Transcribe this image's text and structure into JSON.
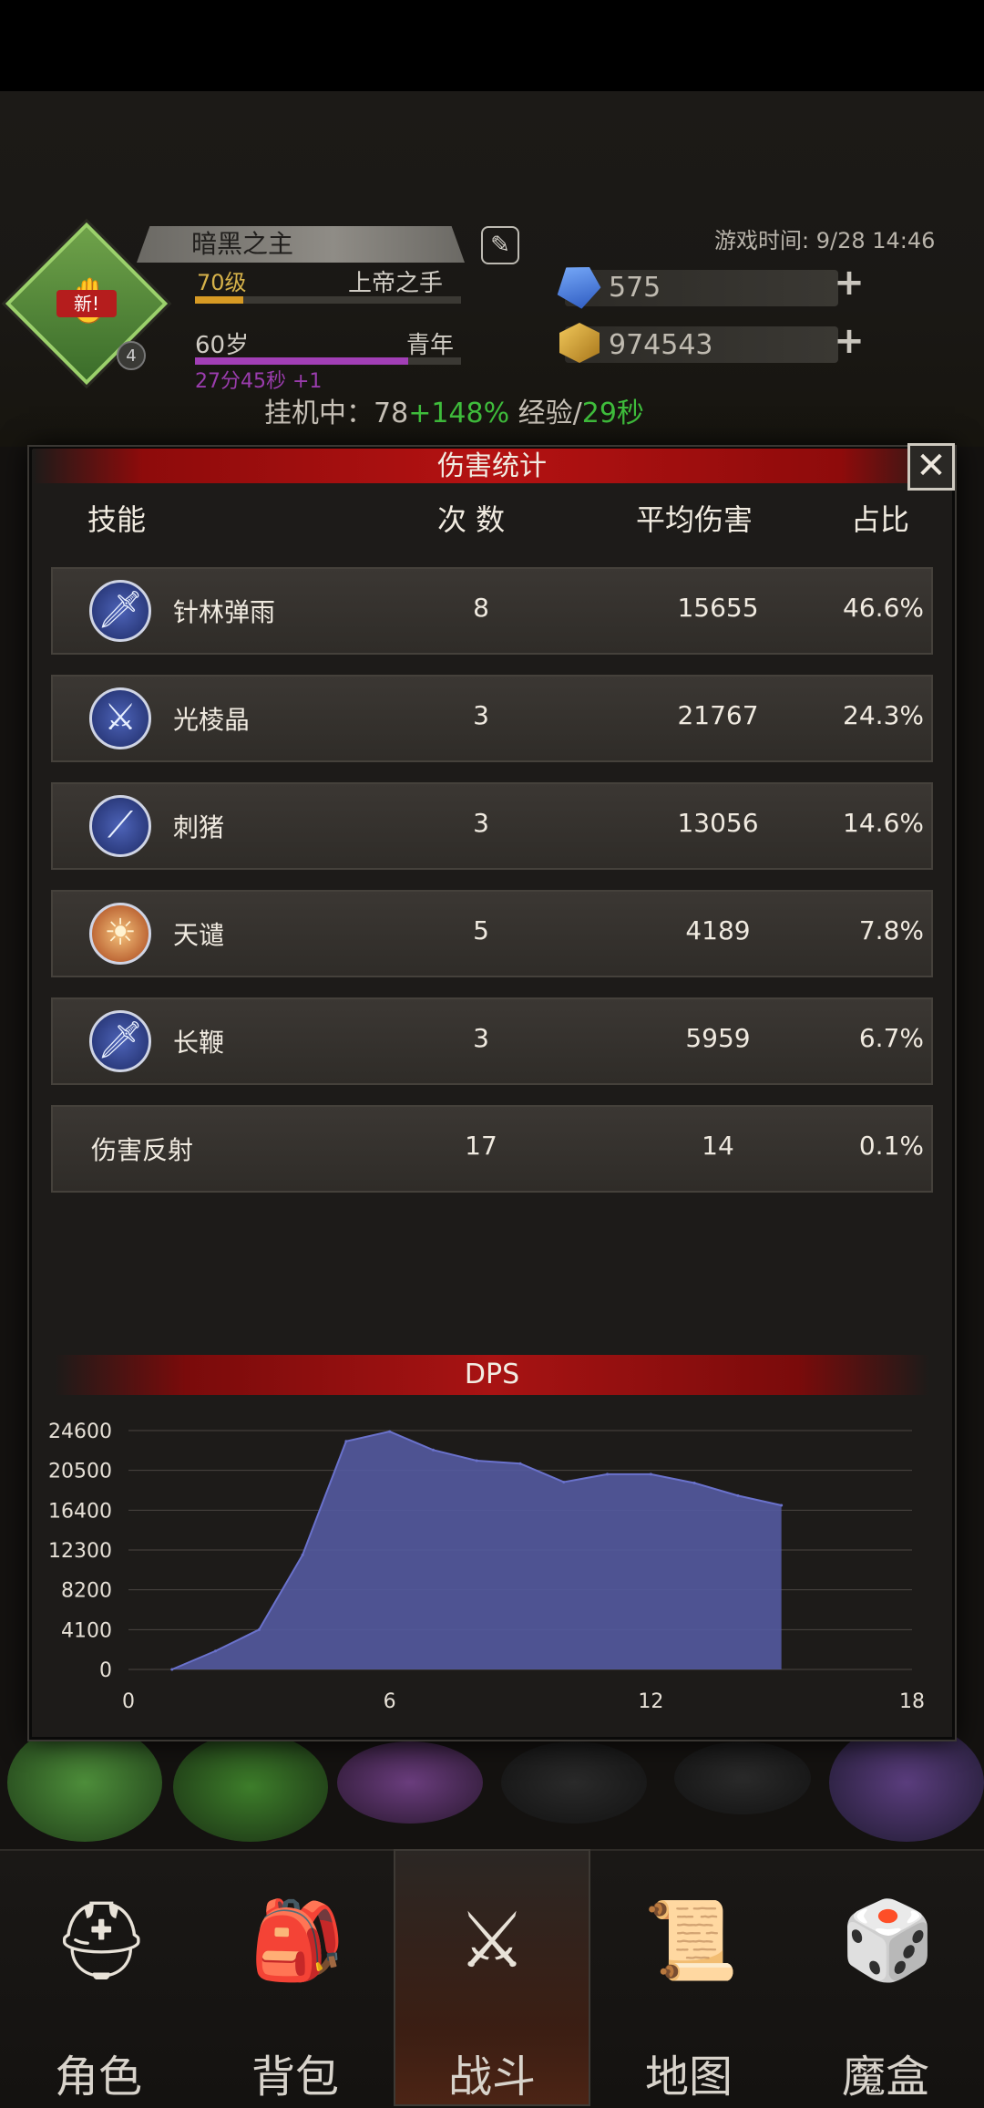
{
  "header": {
    "player_name": "暗黑之主",
    "level": "70级",
    "title": "上帝之手",
    "age": "60岁",
    "age_stage": "青年",
    "age_timer": "27分45秒 +1",
    "new_badge": "新!",
    "avatar_rank": "4",
    "game_time": "游戏时间: 9/28 14:46",
    "gems": "575",
    "gold": "974543",
    "level_progress": 0.18,
    "age_progress": 0.8,
    "idle": {
      "prefix": "挂机中：",
      "value": "78",
      "bonus": "+148%",
      "exp_label": "经验/",
      "interval": "29秒"
    }
  },
  "modal": {
    "title": "伤害统计",
    "close_symbol": "✕",
    "columns": {
      "skill": "技能",
      "count": "次 数",
      "avg": "平均伤害",
      "pct": "占比"
    },
    "rows": [
      {
        "icon": "sword-icon",
        "name": "针林弹雨",
        "count": "8",
        "avg": "15655",
        "pct": "46.6%"
      },
      {
        "icon": "blade-icon",
        "name": "光棱晶",
        "count": "3",
        "avg": "21767",
        "pct": "24.3%"
      },
      {
        "icon": "spikes-icon",
        "name": "刺猪",
        "count": "3",
        "avg": "13056",
        "pct": "14.6%"
      },
      {
        "icon": "fire-figure-icon",
        "name": "天谴",
        "count": "5",
        "avg": "4189",
        "pct": "7.8%"
      },
      {
        "icon": "sword-icon",
        "name": "长鞭",
        "count": "3",
        "avg": "5959",
        "pct": "6.7%"
      },
      {
        "icon": "",
        "name": "伤害反射",
        "count": "17",
        "avg": "14",
        "pct": "0.1%"
      }
    ],
    "dps_title": "DPS"
  },
  "chart_data": {
    "type": "area",
    "title": "DPS",
    "x": [
      1,
      2,
      3,
      4,
      5,
      6,
      7,
      8,
      9,
      10,
      11,
      12,
      13,
      14,
      15
    ],
    "values": [
      0,
      1900,
      4100,
      11800,
      23500,
      24500,
      22600,
      21500,
      21200,
      19300,
      20100,
      20100,
      19200,
      17900,
      16900
    ],
    "xticks": [
      "0",
      "6",
      "12",
      "18"
    ],
    "yticks": [
      "24600",
      "20500",
      "16400",
      "12300",
      "8200",
      "4100",
      "0"
    ],
    "xlim": [
      0,
      18
    ],
    "ylim": [
      0,
      24600
    ],
    "grid": true,
    "fill_color": "#545aa0",
    "line_color": "#6a72cc"
  },
  "nav": [
    {
      "label": "角色",
      "icon": "helmet-icon",
      "glyph": "⛑"
    },
    {
      "label": "背包",
      "icon": "backpack-icon",
      "glyph": "🎒"
    },
    {
      "label": "战斗",
      "icon": "sword-shield-icon",
      "glyph": "⚔"
    },
    {
      "label": "地图",
      "icon": "scroll-map-icon",
      "glyph": "📜"
    },
    {
      "label": "魔盒",
      "icon": "magic-box-icon",
      "glyph": "🎲"
    }
  ],
  "colors": {
    "accent_red": "#b41212",
    "gold_text": "#d6b24a",
    "green": "#3fbd3c",
    "purple": "#a23fb6"
  }
}
